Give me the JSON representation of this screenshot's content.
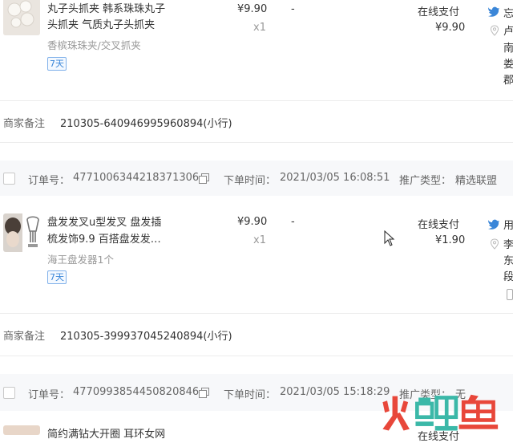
{
  "colors": {
    "accent_blue": "#3a86d8",
    "tag_border": "#7fb0ea",
    "text_main": "#333333",
    "text_muted": "#999999",
    "band_bg": "#f7f8fa",
    "watermark_red": "#e8473a",
    "watermark_teal": "#3bb8a8"
  },
  "orders": [
    {
      "item_title_line1": "丸子头抓夹 韩系珠珠丸子",
      "item_title_line2": "头抓夹 气质丸子头抓夹",
      "item_spec": "香槟珠珠夹/交叉抓夹",
      "service_tag": "7天",
      "unit_price": "¥9.90",
      "quantity": "x1",
      "discount": "-",
      "payment_method": "在线支付",
      "paid_amount": "¥9.90",
      "buyer_name_partial": "忘",
      "address_lines": [
        "卢",
        "南",
        "娄",
        "郡"
      ],
      "merchant_note_label": "商家备注",
      "merchant_note": "210305-640946995960894(小行)"
    },
    {
      "order_no_label": "订单号：",
      "order_no": "4771006344218371306",
      "order_time_label": "下单时间：",
      "order_time": "2021/03/05 16:08:51",
      "promo_label": "推广类型：",
      "promo_type": "精选联盟",
      "item_title_line1": "盘发发叉u型发叉 盘发插",
      "item_title_line2": "梳发饰9.9 百搭盘发发…",
      "item_spec": "海王盘发器1个",
      "service_tag": "7天",
      "unit_price": "¥9.90",
      "quantity": "x1",
      "discount": "-",
      "payment_method": "在线支付",
      "paid_amount": "¥1.90",
      "buyer_name_partial": "用",
      "address_lines": [
        "李",
        "东",
        "段"
      ],
      "merchant_note_label": "商家备注",
      "merchant_note": "210305-399937045240894(小行)"
    },
    {
      "order_no_label": "订单号：",
      "order_no": "4770993854450820846",
      "order_time_label": "下单时间：",
      "order_time": "2021/03/05 15:18:29",
      "promo_label": "推广类型：",
      "promo_type": "无",
      "item_title_partial": "简约满钻大开圈 耳环女网",
      "payment_method_partial": "在线支付"
    }
  ],
  "icons": {
    "copy": "copy-icon",
    "bird": "bird-icon",
    "location_pin": "location-pin-icon",
    "cursor": "mouse-cursor-icon",
    "phone": "phone-icon"
  }
}
